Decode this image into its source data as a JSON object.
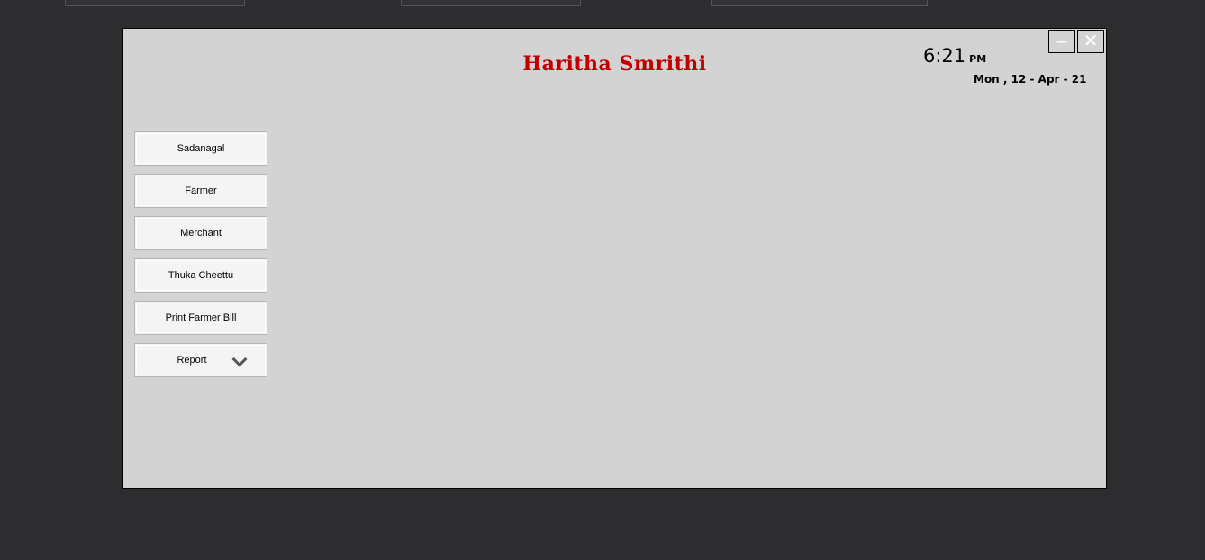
{
  "app": {
    "title": "Haritha  Smrithi"
  },
  "clock": {
    "time": "6:21",
    "ampm": "PM",
    "date": "Mon , 12 - Apr - 21"
  },
  "window_controls": {
    "minimize_icon": "minimize-icon",
    "close_icon": "close-icon"
  },
  "menu": {
    "items": [
      {
        "label": "Sadanagal"
      },
      {
        "label": "Farmer"
      },
      {
        "label": "Merchant"
      },
      {
        "label": "Thuka Cheettu"
      },
      {
        "label": "Print Farmer Bill"
      },
      {
        "label": "Report",
        "icon": "chevron-down-icon"
      }
    ]
  },
  "colors": {
    "title": "#c00000",
    "form_bg": "#d3d3d3",
    "backdrop": "#2d2d30"
  }
}
